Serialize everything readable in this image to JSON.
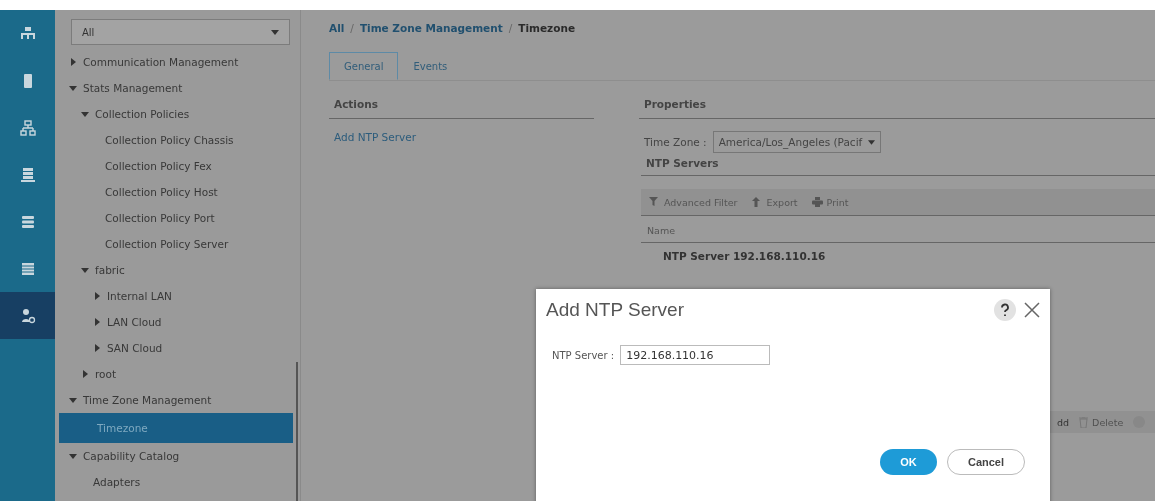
{
  "nav_rail": {
    "items": [
      {
        "selected": false
      },
      {
        "selected": false
      },
      {
        "selected": false
      },
      {
        "selected": false
      },
      {
        "selected": false
      },
      {
        "selected": false
      },
      {
        "selected": true
      }
    ]
  },
  "tree_panel": {
    "filter": {
      "value": "All"
    },
    "items": [
      {
        "label": "Communication Management",
        "expanded": false,
        "selected": false
      },
      {
        "label": "Stats Management",
        "expanded": true,
        "selected": false,
        "children": [
          {
            "label": "Collection Policies",
            "expanded": true,
            "selected": false,
            "children": [
              {
                "label": "Collection Policy Chassis",
                "selected": false
              },
              {
                "label": "Collection Policy Fex",
                "selected": false
              },
              {
                "label": "Collection Policy Host",
                "selected": false
              },
              {
                "label": "Collection Policy Port",
                "selected": false
              },
              {
                "label": "Collection Policy Server",
                "selected": false
              }
            ]
          },
          {
            "label": "fabric",
            "expanded": true,
            "selected": false,
            "children": [
              {
                "label": "Internal LAN",
                "expanded": false,
                "selected": false
              },
              {
                "label": "LAN Cloud",
                "expanded": false,
                "selected": false
              },
              {
                "label": "SAN Cloud",
                "expanded": false,
                "selected": false
              }
            ]
          },
          {
            "label": "root",
            "expanded": false,
            "selected": false
          }
        ]
      },
      {
        "label": "Time Zone Management",
        "expanded": true,
        "selected": false,
        "children": [
          {
            "label": "Timezone",
            "selected": true
          }
        ]
      },
      {
        "label": "Capability Catalog",
        "expanded": true,
        "selected": false,
        "children": [
          {
            "label": "Adapters",
            "selected": false
          }
        ]
      }
    ]
  },
  "breadcrumb_separator": "/",
  "breadcrumb": [
    {
      "label": "All",
      "current": false
    },
    {
      "label": "Time Zone Management",
      "current": false
    },
    {
      "label": "Timezone",
      "current": true
    }
  ],
  "tabs": [
    {
      "label": "General",
      "selected": true
    },
    {
      "label": "Events",
      "selected": false
    }
  ],
  "actions": {
    "title": "Actions",
    "links": [
      "Add NTP Server"
    ]
  },
  "properties": {
    "title": "Properties",
    "time_zone_label": "Time Zone :",
    "time_zone_value": "America/Los_Angeles (Pacif",
    "ntp_servers": {
      "title": "NTP Servers",
      "toolbar": [
        "Advanced Filter",
        "Export",
        "Print"
      ],
      "column": "Name",
      "rows": [
        "NTP Server 192.168.110.16"
      ],
      "bottom_toolbar": [
        "dd",
        "Delete"
      ]
    }
  },
  "dialog": {
    "title": "Add NTP Server",
    "field_label": "NTP Server :",
    "field_value": "192.168.110.16",
    "ok": "OK",
    "cancel": "Cancel"
  }
}
